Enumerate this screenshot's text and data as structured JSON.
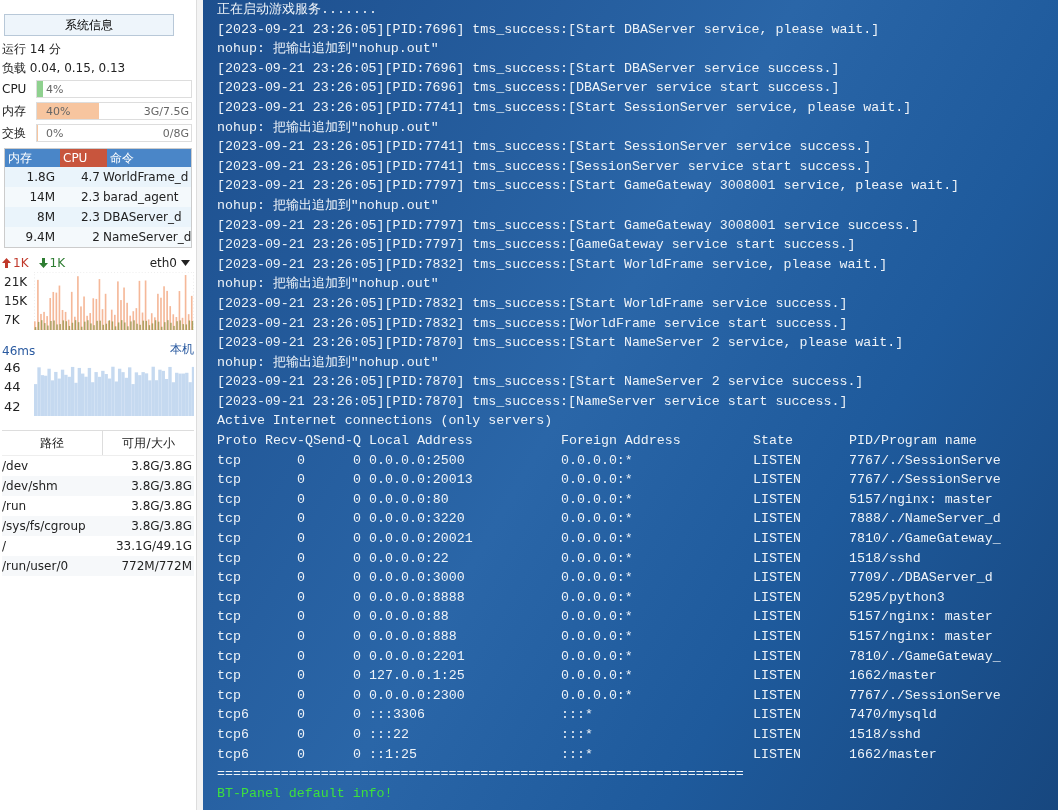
{
  "sidebar": {
    "info_button": "系统信息",
    "uptime": "运行 14 分",
    "load": "负载 0.04, 0.15, 0.13",
    "meters": [
      {
        "label": "CPU",
        "value": "4%",
        "level": 0.04,
        "color": "#8fd18f"
      },
      {
        "label": "内存",
        "value": "40%",
        "detail": "3G/7.5G",
        "level": 0.4,
        "color": "#f7c59f"
      },
      {
        "label": "交换",
        "value": "0%",
        "detail": "0/8G",
        "level": 0
      }
    ],
    "processes": {
      "columns": [
        "内存",
        "CPU",
        "命令"
      ],
      "rows": [
        {
          "mem": "1.8G",
          "cpu": "4.7",
          "cmd": "WorldFrame_d"
        },
        {
          "mem": "14M",
          "cpu": "2.3",
          "cmd": "barad_agent"
        },
        {
          "mem": "8M",
          "cpu": "2.3",
          "cmd": "DBAServer_d"
        },
        {
          "mem": "9.4M",
          "cpu": "2",
          "cmd": "NameServer_d"
        }
      ]
    },
    "network": {
      "up": "1K",
      "down": "1K",
      "interface": "eth0",
      "ticks": [
        "21K",
        "15K",
        "7K"
      ]
    },
    "ping": {
      "latency": "46ms",
      "host": "本机",
      "ticks": [
        "46",
        "44",
        "42"
      ]
    },
    "disks": {
      "columns": [
        "路径",
        "可用/大小"
      ],
      "rows": [
        {
          "path": "/dev",
          "size": "3.8G/3.8G"
        },
        {
          "path": "/dev/shm",
          "size": "3.8G/3.8G"
        },
        {
          "path": "/run",
          "size": "3.8G/3.8G"
        },
        {
          "path": "/sys/fs/cgroup",
          "size": "3.8G/3.8G"
        },
        {
          "path": "/",
          "size": "33.1G/49.1G"
        },
        {
          "path": "/run/user/0",
          "size": "772M/772M"
        }
      ]
    }
  },
  "terminal": {
    "lines": [
      "正在启动游戏服务.......",
      "[2023-09-21 23:26:05][PID:7696] tms_success:[Start DBAServer service, please wait.]",
      "nohup: 把输出追加到\"nohup.out\"",
      "[2023-09-21 23:26:05][PID:7696] tms_success:[Start DBAServer service success.]",
      "[2023-09-21 23:26:05][PID:7696] tms_success:[DBAServer service start success.]",
      "[2023-09-21 23:26:05][PID:7741] tms_success:[Start SessionServer service, please wait.]",
      "nohup: 把输出追加到\"nohup.out\"",
      "[2023-09-21 23:26:05][PID:7741] tms_success:[Start SessionServer service success.]",
      "[2023-09-21 23:26:05][PID:7741] tms_success:[SessionServer service start success.]",
      "[2023-09-21 23:26:05][PID:7797] tms_success:[Start GameGateway 3008001 service, please wait.]",
      "nohup: 把输出追加到\"nohup.out\"",
      "[2023-09-21 23:26:05][PID:7797] tms_success:[Start GameGateway 3008001 service success.]",
      "[2023-09-21 23:26:05][PID:7797] tms_success:[GameGateway service start success.]",
      "[2023-09-21 23:26:05][PID:7832] tms_success:[Start WorldFrame service, please wait.]",
      "nohup: 把输出追加到\"nohup.out\"",
      "[2023-09-21 23:26:05][PID:7832] tms_success:[Start WorldFrame service success.]",
      "[2023-09-21 23:26:05][PID:7832] tms_success:[WorldFrame service start success.]",
      "[2023-09-21 23:26:05][PID:7870] tms_success:[Start NameServer 2 service, please wait.]",
      "nohup: 把输出追加到\"nohup.out\"",
      "[2023-09-21 23:26:05][PID:7870] tms_success:[Start NameServer 2 service success.]",
      "[2023-09-21 23:26:05][PID:7870] tms_success:[NameServer service start success.]",
      "Active Internet connections (only servers)"
    ],
    "netstat": {
      "columns": [
        "Proto",
        "Recv-Q",
        "Send-Q",
        "Local Address",
        "Foreign Address",
        "State",
        "PID/Program name"
      ],
      "rows": [
        [
          "tcp",
          "0",
          "0",
          "0.0.0.0:2500",
          "0.0.0.0:*",
          "LISTEN",
          "7767/./SessionServe"
        ],
        [
          "tcp",
          "0",
          "0",
          "0.0.0.0:20013",
          "0.0.0.0:*",
          "LISTEN",
          "7767/./SessionServe"
        ],
        [
          "tcp",
          "0",
          "0",
          "0.0.0.0:80",
          "0.0.0.0:*",
          "LISTEN",
          "5157/nginx: master"
        ],
        [
          "tcp",
          "0",
          "0",
          "0.0.0.0:3220",
          "0.0.0.0:*",
          "LISTEN",
          "7888/./NameServer_d"
        ],
        [
          "tcp",
          "0",
          "0",
          "0.0.0.0:20021",
          "0.0.0.0:*",
          "LISTEN",
          "7810/./GameGateway_"
        ],
        [
          "tcp",
          "0",
          "0",
          "0.0.0.0:22",
          "0.0.0.0:*",
          "LISTEN",
          "1518/sshd"
        ],
        [
          "tcp",
          "0",
          "0",
          "0.0.0.0:3000",
          "0.0.0.0:*",
          "LISTEN",
          "7709/./DBAServer_d"
        ],
        [
          "tcp",
          "0",
          "0",
          "0.0.0.0:8888",
          "0.0.0.0:*",
          "LISTEN",
          "5295/python3"
        ],
        [
          "tcp",
          "0",
          "0",
          "0.0.0.0:88",
          "0.0.0.0:*",
          "LISTEN",
          "5157/nginx: master"
        ],
        [
          "tcp",
          "0",
          "0",
          "0.0.0.0:888",
          "0.0.0.0:*",
          "LISTEN",
          "5157/nginx: master"
        ],
        [
          "tcp",
          "0",
          "0",
          "0.0.0.0:2201",
          "0.0.0.0:*",
          "LISTEN",
          "7810/./GameGateway_"
        ],
        [
          "tcp",
          "0",
          "0",
          "127.0.0.1:25",
          "0.0.0.0:*",
          "LISTEN",
          "1662/master"
        ],
        [
          "tcp",
          "0",
          "0",
          "0.0.0.0:2300",
          "0.0.0.0:*",
          "LISTEN",
          "7767/./SessionServe"
        ],
        [
          "tcp6",
          "0",
          "0",
          ":::3306",
          ":::*",
          "LISTEN",
          "7470/mysqld"
        ],
        [
          "tcp6",
          "0",
          "0",
          ":::22",
          ":::*",
          "LISTEN",
          "1518/sshd"
        ],
        [
          "tcp6",
          "0",
          "0",
          "::1:25",
          ":::*",
          "LISTEN",
          "1662/master"
        ]
      ]
    },
    "separator": "==================================================================",
    "footer": "BT-Panel default info!"
  }
}
